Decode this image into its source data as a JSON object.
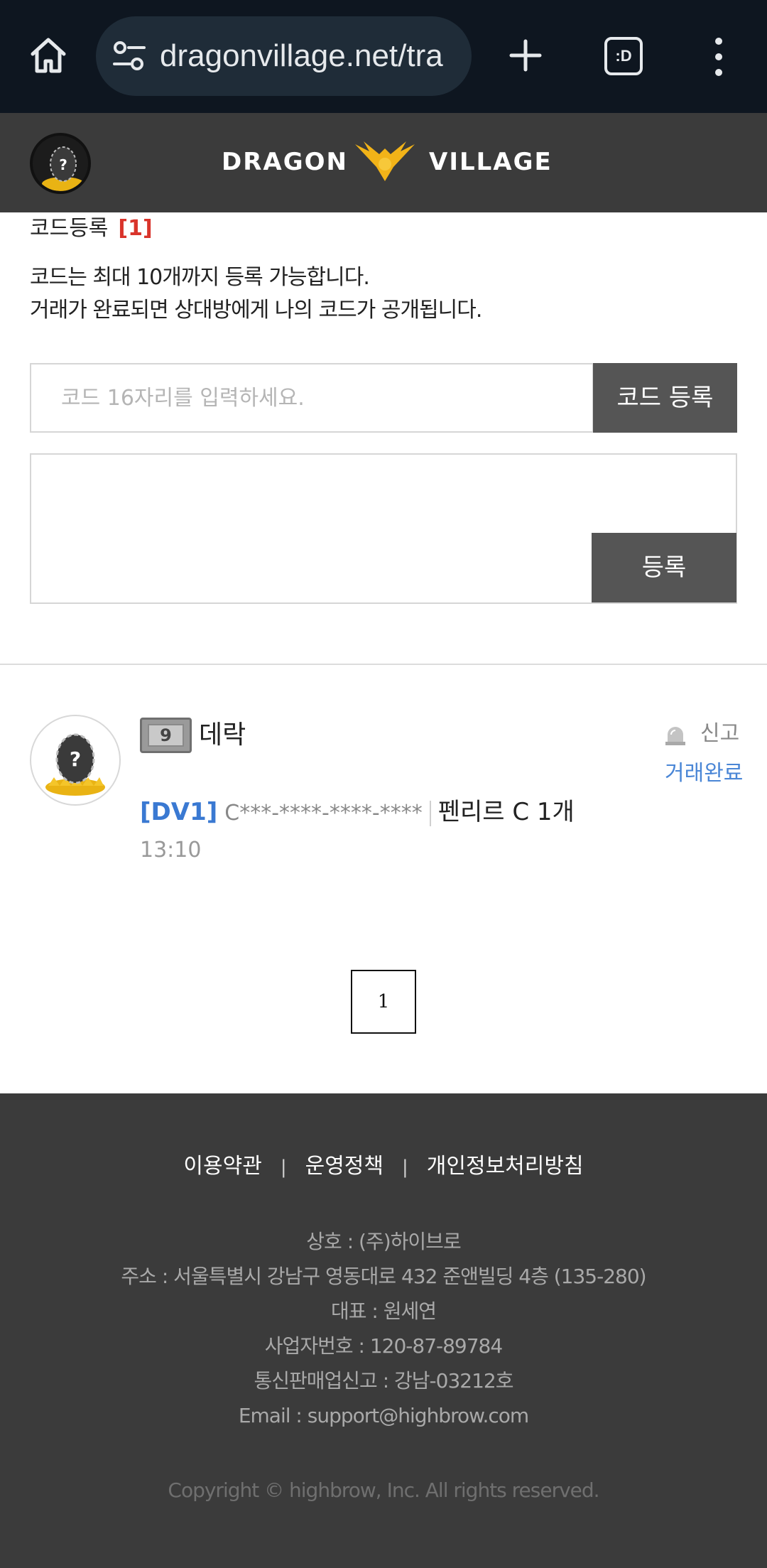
{
  "browser": {
    "url": "dragonvillage.net/tra",
    "tabs_label": ":D"
  },
  "header": {
    "logo_left": "DRAGON",
    "logo_right": "VILLAGE"
  },
  "code_register": {
    "title": "코드등록",
    "count": "[1]",
    "desc_line1": "코드는 최대 10개까지 등록 가능합니다.",
    "desc_line2": "거래가 완료되면 상대방에게 나의 코드가 공개됩니다.",
    "input_placeholder": "코드 16자리를 입력하세요.",
    "code_button": "코드 등록",
    "register_button": "등록"
  },
  "trade": {
    "level": "9",
    "username": "데락",
    "report_label": "신고",
    "status": "거래완료",
    "game": "[DV1]",
    "code": "C***-****-****-****",
    "item": "펜리르 C 1개",
    "time": "13:10"
  },
  "pagination": {
    "current_page": "1"
  },
  "footer": {
    "links": [
      "이용약관",
      "운영정책",
      "개인정보처리방침"
    ],
    "company_lines": [
      "상호 : (주)하이브로",
      "주소 : 서울특별시 강남구 영동대로 432 준앤빌딩 4층 (135-280)",
      "대표 : 원세연",
      "사업자번호 : 120-87-89784",
      "통신판매업신고 : 강남-03212호",
      "Email : support@highbrow.com"
    ],
    "copyright": "Copyright © highbrow, Inc. All rights reserved."
  }
}
